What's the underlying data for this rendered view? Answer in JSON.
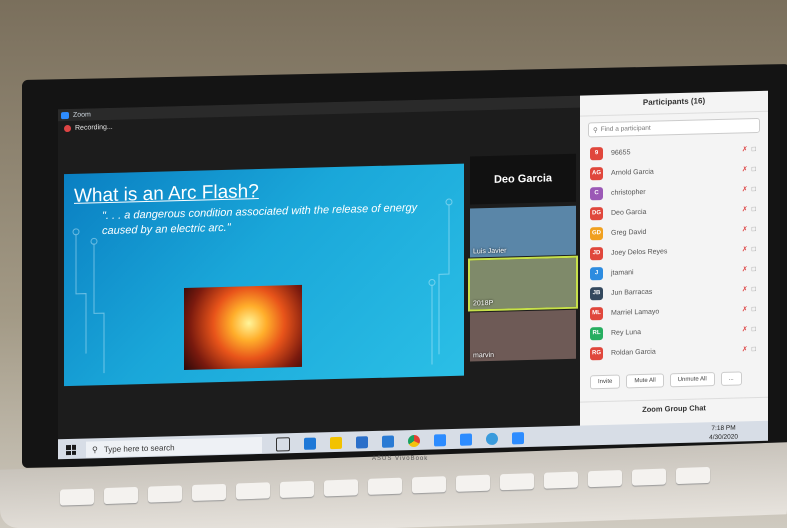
{
  "zoom_window": {
    "title": "Zoom",
    "recording_label": "Recording..."
  },
  "slide": {
    "title": "What is an Arc Flash?",
    "quote": "\". . . a dangerous condition associated with the release of energy caused by an electric arc.\""
  },
  "active_speaker": {
    "name": "Deo Garcia"
  },
  "video_tiles": [
    {
      "name": "Luis Javier",
      "bg": "#5a86a8"
    },
    {
      "name": "2018P",
      "bg": "#7f8a6a"
    },
    {
      "name": "marvin",
      "bg": "#6e5a56"
    }
  ],
  "participants_panel": {
    "title": "Participants (16)",
    "search_placeholder": "Find a participant",
    "participants": [
      {
        "initials": "9",
        "name": "96655",
        "color": "#e0473c"
      },
      {
        "initials": "AG",
        "name": "Arnold Garcia",
        "color": "#e0473c"
      },
      {
        "initials": "C",
        "name": "christopher",
        "color": "#9b59b6"
      },
      {
        "initials": "DG",
        "name": "Deo Garcia",
        "color": "#e0473c"
      },
      {
        "initials": "GD",
        "name": "Greg David",
        "color": "#f0a020"
      },
      {
        "initials": "JD",
        "name": "Joey Delos Reyes",
        "color": "#e0473c"
      },
      {
        "initials": "J",
        "name": "jtamani",
        "color": "#2d8ce0"
      },
      {
        "initials": "JB",
        "name": "Jun Barracas",
        "color": "#34495e"
      },
      {
        "initials": "ML",
        "name": "Marriel Lamayo",
        "color": "#e0473c"
      },
      {
        "initials": "RL",
        "name": "Rey Luna",
        "color": "#27ae60"
      },
      {
        "initials": "RG",
        "name": "Roldan Garcia",
        "color": "#e0473c"
      }
    ],
    "buttons": {
      "invite": "Invite",
      "mute_all": "Mute All",
      "unmute_all": "Unmute All",
      "more": "..."
    },
    "group_chat_label": "Zoom Group Chat"
  },
  "taskbar": {
    "search_placeholder": "Type here to search",
    "time": "7:18 PM",
    "date": "4/30/2020"
  },
  "laptop_brand": "ASUS VivoBook"
}
